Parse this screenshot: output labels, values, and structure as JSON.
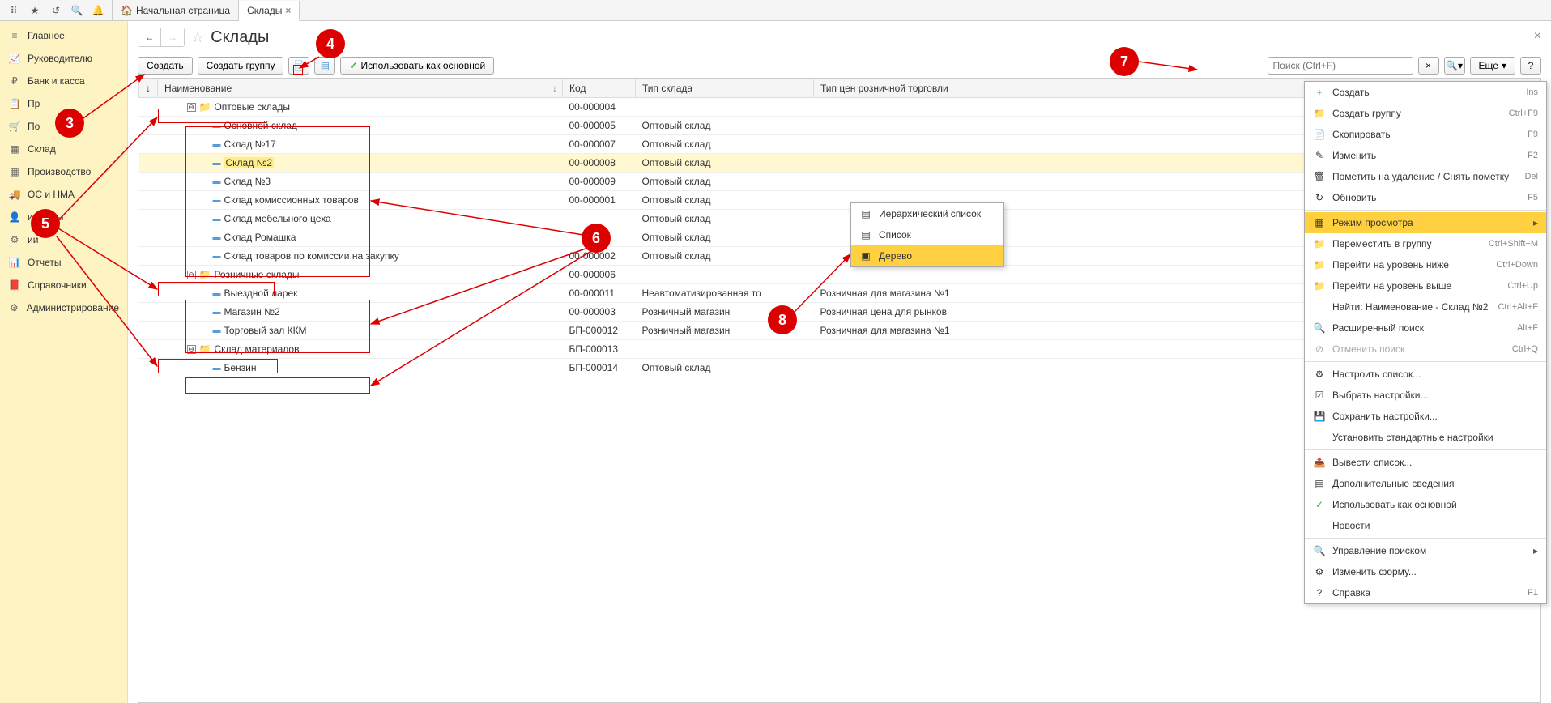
{
  "topbar": {
    "home_tab": "Начальная страница",
    "active_tab": "Склады"
  },
  "sidebar": {
    "items": [
      {
        "label": "Главное",
        "icon": "≡"
      },
      {
        "label": "Руководителю",
        "icon": "📈"
      },
      {
        "label": "Банк и касса",
        "icon": "₽"
      },
      {
        "label": "Пр",
        "icon": "📋"
      },
      {
        "label": "По",
        "icon": "🛒"
      },
      {
        "label": "Склад",
        "icon": "▦"
      },
      {
        "label": "Производство",
        "icon": "▦"
      },
      {
        "label": "ОС и НМА",
        "icon": "🚚"
      },
      {
        "label": "и кадры",
        "icon": "👤"
      },
      {
        "label": "ии",
        "icon": "⚙"
      },
      {
        "label": "Отчеты",
        "icon": "📊"
      },
      {
        "label": "Справочники",
        "icon": "📕"
      },
      {
        "label": "Администрирование",
        "icon": "⚙"
      }
    ]
  },
  "page": {
    "title": "Склады"
  },
  "toolbar": {
    "create": "Создать",
    "create_group": "Создать группу",
    "use_as_main": "Использовать как основной",
    "search_placeholder": "Поиск (Ctrl+F)",
    "more": "Еще",
    "help": "?"
  },
  "columns": {
    "name": "Наименование",
    "code": "Код",
    "type": "Тип склада",
    "price_type": "Тип цен розничной торговли"
  },
  "rows": [
    {
      "level": 0,
      "folder": true,
      "toggle": "⊖",
      "name": "Оптовые склады",
      "code": "00-000004",
      "type": "",
      "price": "",
      "hl": false
    },
    {
      "level": 1,
      "folder": false,
      "name": "Основной склад",
      "code": "00-000005",
      "type": "Оптовый склад",
      "price": "",
      "hl": false
    },
    {
      "level": 1,
      "folder": false,
      "name": "Склад №17",
      "code": "00-000007",
      "type": "Оптовый склад",
      "price": "",
      "hl": false
    },
    {
      "level": 1,
      "folder": false,
      "name": "Склад №2",
      "code": "00-000008",
      "type": "Оптовый склад",
      "price": "",
      "hl": true,
      "hltext": true
    },
    {
      "level": 1,
      "folder": false,
      "name": "Склад №3",
      "code": "00-000009",
      "type": "Оптовый склад",
      "price": "",
      "hl": false
    },
    {
      "level": 1,
      "folder": false,
      "name": "Склад комиссионных товаров",
      "code": "00-000001",
      "type": "Оптовый склад",
      "price": "",
      "hl": false
    },
    {
      "level": 1,
      "folder": false,
      "name": "Склад мебельного цеха",
      "code": "",
      "type": "Оптовый склад",
      "price": "",
      "hl": false
    },
    {
      "level": 1,
      "folder": false,
      "name": "Склад Ромашка",
      "code": "",
      "type": "Оптовый склад",
      "price": "",
      "hl": false
    },
    {
      "level": 1,
      "folder": false,
      "name": "Склад товаров по комиссии на закупку",
      "code": "00-000002",
      "type": "Оптовый склад",
      "price": "",
      "hl": false
    },
    {
      "level": 0,
      "folder": true,
      "toggle": "⊖",
      "name": "Розничные склады",
      "code": "00-000006",
      "type": "",
      "price": "",
      "hl": false
    },
    {
      "level": 1,
      "folder": false,
      "name": "Выездной ларек",
      "code": "00-000011",
      "type": "Неавтоматизированная то",
      "price": "Розничная для магазина №1",
      "hl": false
    },
    {
      "level": 1,
      "folder": false,
      "name": "Магазин №2",
      "code": "00-000003",
      "type": "Розничный магазин",
      "price": "Розничная цена для рынков",
      "hl": false
    },
    {
      "level": 1,
      "folder": false,
      "name": "Торговый зал ККМ",
      "code": "БП-000012",
      "type": "Розничный магазин",
      "price": "Розничная для магазина №1",
      "hl": false
    },
    {
      "level": 0,
      "folder": true,
      "toggle": "⊖",
      "name": "Склад материалов",
      "code": "БП-000013",
      "type": "",
      "price": "",
      "hl": false
    },
    {
      "level": 1,
      "folder": false,
      "name": "Бензин",
      "code": "БП-000014",
      "type": "Оптовый склад",
      "price": "",
      "hl": false
    }
  ],
  "menu": {
    "items": [
      {
        "icon": "+",
        "label": "Создать",
        "shortcut": "Ins",
        "color": "#4a4"
      },
      {
        "icon": "📁",
        "label": "Создать группу",
        "shortcut": "Ctrl+F9"
      },
      {
        "icon": "📄",
        "label": "Скопировать",
        "shortcut": "F9"
      },
      {
        "icon": "✎",
        "label": "Изменить",
        "shortcut": "F2"
      },
      {
        "icon": "🗑",
        "label": "Пометить на удаление / Снять пометку",
        "shortcut": "Del"
      },
      {
        "icon": "↻",
        "label": "Обновить",
        "shortcut": "F5"
      },
      {
        "sep": true
      },
      {
        "icon": "▦",
        "label": "Режим просмотра",
        "arrow": true,
        "hl": true
      },
      {
        "icon": "📁",
        "label": "Переместить в группу",
        "shortcut": "Ctrl+Shift+M"
      },
      {
        "icon": "📁",
        "label": "Перейти на уровень ниже",
        "shortcut": "Ctrl+Down"
      },
      {
        "icon": "📁",
        "label": "Перейти на уровень выше",
        "shortcut": "Ctrl+Up"
      },
      {
        "icon": "",
        "label": "Найти: Наименование - Склад №2",
        "shortcut": "Ctrl+Alt+F"
      },
      {
        "icon": "🔍",
        "label": "Расширенный поиск",
        "shortcut": "Alt+F"
      },
      {
        "icon": "⊘",
        "label": "Отменить поиск",
        "shortcut": "Ctrl+Q",
        "disabled": true
      },
      {
        "sep": true
      },
      {
        "icon": "⚙",
        "label": "Настроить список..."
      },
      {
        "icon": "☑",
        "label": "Выбрать настройки..."
      },
      {
        "icon": "💾",
        "label": "Сохранить настройки..."
      },
      {
        "icon": "",
        "label": "Установить стандартные настройки"
      },
      {
        "sep": true
      },
      {
        "icon": "📤",
        "label": "Вывести список..."
      },
      {
        "icon": "▤",
        "label": "Дополнительные сведения"
      },
      {
        "icon": "✓",
        "label": "Использовать как основной",
        "green": true
      },
      {
        "icon": "",
        "label": "Новости"
      },
      {
        "sep": true
      },
      {
        "icon": "🔍",
        "label": "Управление поиском",
        "arrow": true
      },
      {
        "icon": "⚙",
        "label": "Изменить форму..."
      },
      {
        "icon": "?",
        "label": "Справка",
        "shortcut": "F1"
      }
    ]
  },
  "submenu": {
    "items": [
      {
        "icon": "▤",
        "label": "Иерархический список"
      },
      {
        "icon": "▤",
        "label": "Список"
      },
      {
        "icon": "▣",
        "label": "Дерево",
        "hl": true
      }
    ]
  },
  "annotations": {
    "n3": "3",
    "n4": "4",
    "n5": "5",
    "n6": "6",
    "n7": "7",
    "n8": "8"
  }
}
